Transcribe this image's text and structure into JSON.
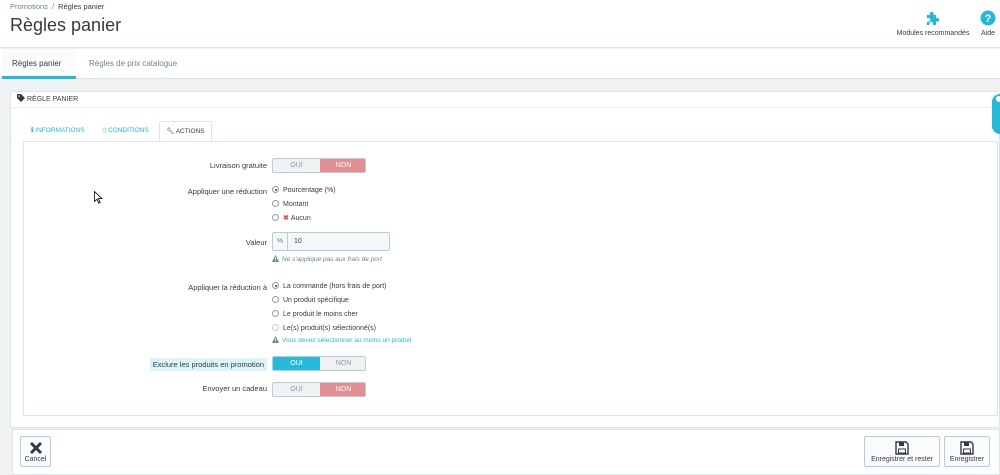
{
  "breadcrumb": {
    "parent": "Promotions",
    "separator": "/",
    "current": "Règles panier"
  },
  "page_title": "Règles panier",
  "toolbar": {
    "modules_label": "Modules recommandés",
    "help_label": "Aide",
    "accent_color": "#25b9d7"
  },
  "page_tabs": [
    {
      "label": "Règles panier",
      "active": true
    },
    {
      "label": "Règles de prix catalogue",
      "active": false
    }
  ],
  "panel": {
    "heading": "Règle panier",
    "tabs": [
      {
        "label": "Informations",
        "icon": "info-icon"
      },
      {
        "label": "Conditions",
        "icon": "shuffle-icon"
      },
      {
        "label": "Actions",
        "icon": "wrench-icon",
        "active": true
      }
    ]
  },
  "form": {
    "free_shipping": {
      "label": "Livraison gratuite",
      "yes": "OUI",
      "no": "NON",
      "value": "NON"
    },
    "apply_discount": {
      "label": "Appliquer une réduction",
      "options": [
        "Pourcentage (%)",
        "Montant",
        "Aucun"
      ],
      "selected": "Pourcentage (%)"
    },
    "value": {
      "label": "Valeur",
      "addon": "%",
      "value": "10",
      "help": "Ne s'applique pas aux frais de port"
    },
    "apply_to": {
      "label": "Appliquer la réduction à",
      "options": [
        "La commande (hors frais de port)",
        "Un produit spécifique",
        "Le produit le moins cher",
        "Le(s) produit(s) sélectionné(s)"
      ],
      "selected": "La commande (hors frais de port)",
      "help": "Vous devez sélectionner au moins un produit"
    },
    "exclude_promo": {
      "label": "Exclure les produits en promotion",
      "yes": "OUI",
      "no": "NON",
      "value": "OUI"
    },
    "send_gift": {
      "label": "Envoyer un cadeau",
      "yes": "OUI",
      "no": "NON",
      "value": "NON"
    }
  },
  "footer": {
    "cancel_label": "Cancel",
    "save_stay_label": "Enregistrer et rester",
    "save_label": "Enregistrer"
  }
}
